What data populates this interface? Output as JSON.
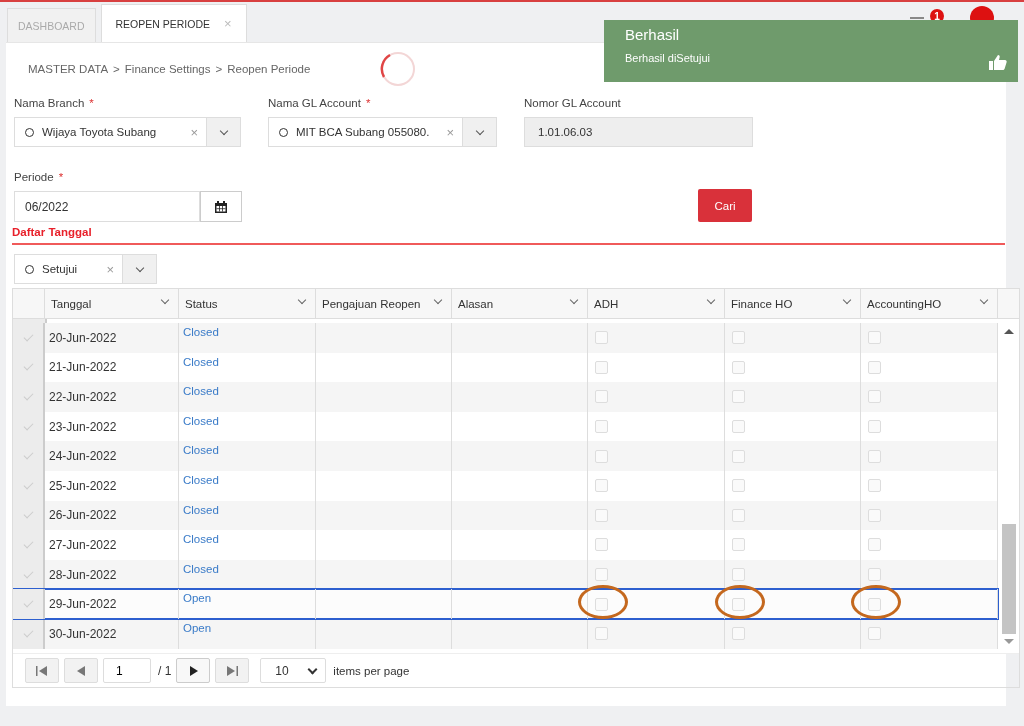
{
  "tabs": [
    {
      "label": "DASHBOARD",
      "selected": false
    },
    {
      "label": "REOPEN PERIODE",
      "selected": true,
      "close": "×"
    }
  ],
  "header": {
    "notification_count": "1"
  },
  "toast": {
    "title": "Berhasil",
    "message": "Berhasil diSetujui"
  },
  "breadcrumb": [
    "MASTER DATA",
    "Finance Settings",
    "Reopen Periode"
  ],
  "breadcrumb_separator": ">",
  "form": {
    "branch": {
      "label": "Nama Branch",
      "required_mark": "*",
      "value": "Wijaya Toyota Subang",
      "clear": "×"
    },
    "gl_account": {
      "label": "Nama GL Account",
      "required_mark": "*",
      "value": "MIT BCA Subang 055080.",
      "clear": "×"
    },
    "gl_number": {
      "label": "Nomor GL Account",
      "value": "1.01.06.03"
    },
    "periode": {
      "label": "Periode",
      "required_mark": "*",
      "value": "06/2022"
    },
    "search_button": "Cari"
  },
  "section_title": "Daftar Tanggal",
  "filter": {
    "value": "Setujui",
    "clear": "×"
  },
  "table": {
    "columns": [
      "Tanggal",
      "Status",
      "Pengajuan Reopen",
      "Alasan",
      "ADH",
      "Finance HO",
      "AccountingHO"
    ],
    "rows": [
      {
        "tanggal": "20-Jun-2022",
        "status": "Closed",
        "highlighted": false,
        "adh": false,
        "finance": false,
        "accounting": false
      },
      {
        "tanggal": "21-Jun-2022",
        "status": "Closed",
        "highlighted": false,
        "adh": false,
        "finance": false,
        "accounting": false
      },
      {
        "tanggal": "22-Jun-2022",
        "status": "Closed",
        "highlighted": false,
        "adh": false,
        "finance": false,
        "accounting": false
      },
      {
        "tanggal": "23-Jun-2022",
        "status": "Closed",
        "highlighted": false,
        "adh": false,
        "finance": false,
        "accounting": false
      },
      {
        "tanggal": "24-Jun-2022",
        "status": "Closed",
        "highlighted": false,
        "adh": false,
        "finance": false,
        "accounting": false
      },
      {
        "tanggal": "25-Jun-2022",
        "status": "Closed",
        "highlighted": false,
        "adh": false,
        "finance": false,
        "accounting": false
      },
      {
        "tanggal": "26-Jun-2022",
        "status": "Closed",
        "highlighted": false,
        "adh": false,
        "finance": false,
        "accounting": false
      },
      {
        "tanggal": "27-Jun-2022",
        "status": "Closed",
        "highlighted": false,
        "adh": false,
        "finance": false,
        "accounting": false
      },
      {
        "tanggal": "28-Jun-2022",
        "status": "Closed",
        "highlighted": false,
        "adh": false,
        "finance": false,
        "accounting": false
      },
      {
        "tanggal": "29-Jun-2022",
        "status": "Open",
        "highlighted": true,
        "adh": false,
        "finance": false,
        "accounting": false
      },
      {
        "tanggal": "30-Jun-2022",
        "status": "Open",
        "highlighted": false,
        "adh": false,
        "finance": false,
        "accounting": false
      }
    ]
  },
  "pager": {
    "page": "1",
    "total": "/ 1",
    "page_size": "10",
    "page_size_label": "items per page"
  }
}
